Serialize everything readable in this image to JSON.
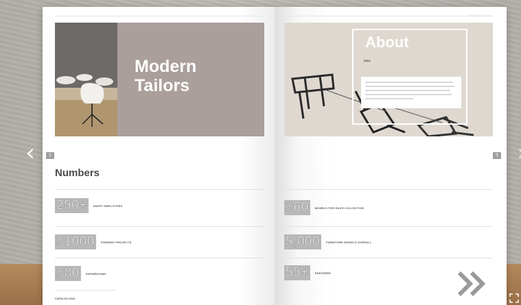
{
  "nav": {
    "prev_label": "‹",
    "next_label": "›"
  },
  "left_page": {
    "hero_title_line1": "Modern",
    "hero_title_line2": "Tailors",
    "page_number": "2",
    "section_heading": "Numbers",
    "stats": [
      {
        "value": "250+",
        "label": "HAPPY EMPLOYEES"
      },
      {
        "value": ">1000",
        "label": "FINISHED PROJECTS"
      },
      {
        "value": ">80",
        "label": "SHOWROOMS"
      }
    ],
    "footer": "CATALOG 2016"
  },
  "right_page": {
    "header_tag": "CATALOG 2016",
    "about_title": "About",
    "about_subtitle": "IDEA",
    "page_number": "3",
    "stats": [
      {
        "value": ">60",
        "label": "MODELS FOR EACH COLLECTION"
      },
      {
        "value": "5,000",
        "label": "FURNITURE MODELS OVERALL"
      },
      {
        "value": "55+",
        "label": "PARTNERS"
      }
    ]
  },
  "icons": {
    "prev": "chevron-left-icon",
    "next": "chevron-right-icon",
    "page_turn": "double-chevron-right-icon",
    "corner": "fullscreen-icon"
  },
  "colors": {
    "hero_left_bg": "#aa9f9b",
    "hero_right_bg": "#ded8d0",
    "stat_bg": "#b8b8b8",
    "page_number_bg": "#9f9f9f"
  }
}
